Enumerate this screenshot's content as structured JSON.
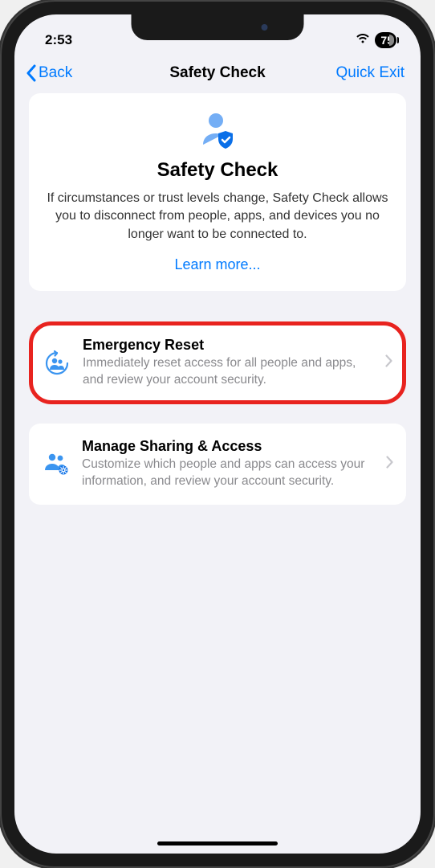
{
  "status": {
    "time": "2:53",
    "battery": "75"
  },
  "nav": {
    "back": "Back",
    "title": "Safety Check",
    "action": "Quick Exit"
  },
  "intro": {
    "title": "Safety Check",
    "description": "If circumstances or trust levels change, Safety Check allows you to disconnect from people, apps, and devices you no longer want to be connected to.",
    "learn_more": "Learn more..."
  },
  "options": {
    "emergency": {
      "title": "Emergency Reset",
      "description": "Immediately reset access for all people and apps, and review your account security."
    },
    "manage": {
      "title": "Manage Sharing & Access",
      "description": "Customize which people and apps can access your information, and review your account security."
    }
  }
}
